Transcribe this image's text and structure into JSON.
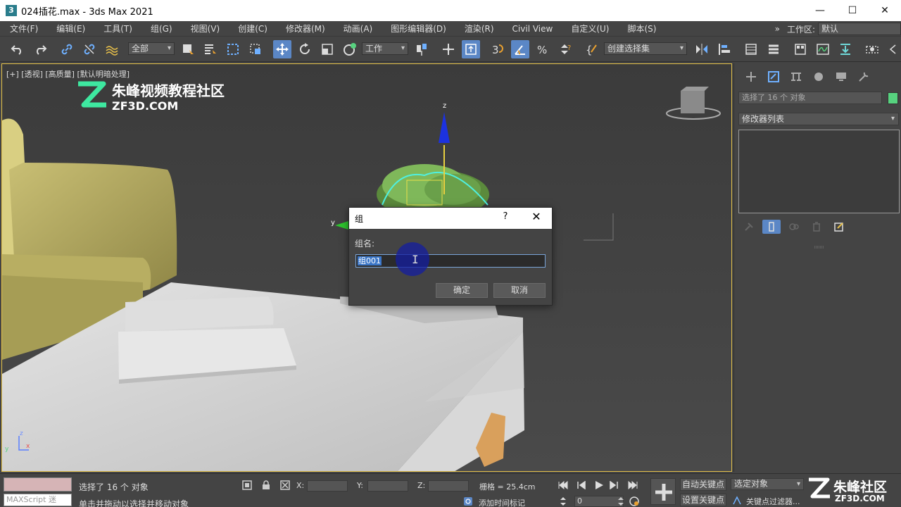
{
  "window": {
    "app_icon_glyph": "3",
    "title": "024插花.max - 3ds Max 2021",
    "minimize": "—",
    "maximize": "☐",
    "close": "✕"
  },
  "menu": {
    "items": [
      "文件(F)",
      "编辑(E)",
      "工具(T)",
      "组(G)",
      "视图(V)",
      "创建(C)",
      "修改器(M)",
      "动画(A)",
      "图形编辑器(D)",
      "渲染(R)",
      "Civil View",
      "自定义(U)",
      "脚本(S)"
    ],
    "more": "»",
    "workspace_label": "工作区:",
    "workspace_value": "默认"
  },
  "toolbar": {
    "selection_filter": "全部",
    "reference_coord": "工作",
    "named_selection": "创建选择集"
  },
  "viewport": {
    "label": "[+] [透视] [高质量] [默认明暗处理]",
    "watermark_title": "朱峰视频教程社区",
    "watermark_sub": "ZF3D.COM",
    "gizmo_z": "z",
    "gizmo_y": "y",
    "axis_z": "z",
    "axis_y": "y",
    "axis_x": "x"
  },
  "dialog": {
    "title": "组",
    "help": "?",
    "close": "✕",
    "label": "组名:",
    "input_value": "组001",
    "ok": "确定",
    "cancel": "取消"
  },
  "command_panel": {
    "selection_info": "选择了 16 个 对象",
    "modifier_list": "修改器列表",
    "object_color": "#57d27f"
  },
  "status": {
    "maxscript_placeholder": "MAXScript 迷",
    "selected": "选择了 16 个 对象",
    "prompt": "单击并拖动以选择并移动对象",
    "x_label": "X:",
    "y_label": "Y:",
    "z_label": "Z:",
    "grid": "栅格 = 25.4cm",
    "add_time_tag": "添加时间标记",
    "auto_key": "自动关键点",
    "set_key": "设置关键点",
    "selected_object": "选定对象",
    "key_filters": "关键点过滤器...",
    "frame": "0",
    "watermark_title": "朱峰社区",
    "watermark_sub": "ZF3D.COM"
  }
}
